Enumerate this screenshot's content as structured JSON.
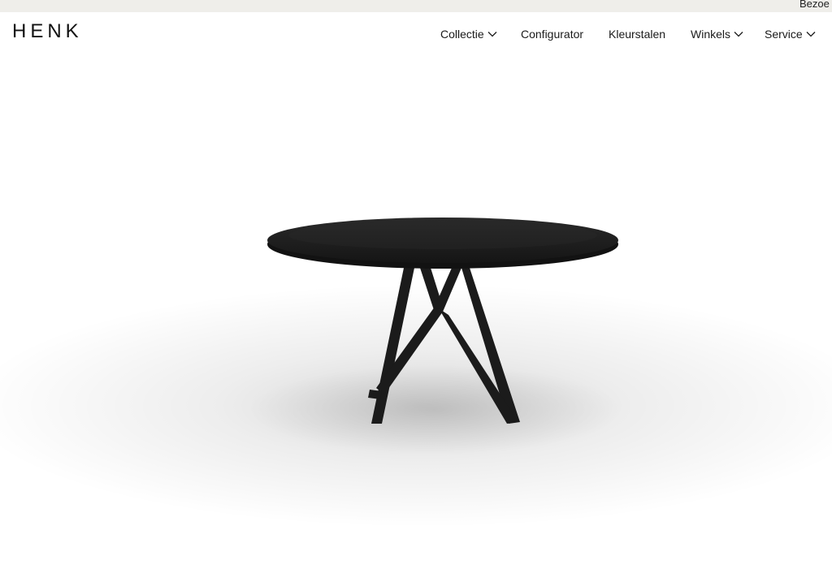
{
  "topbar": {
    "text": "Bezoe"
  },
  "header": {
    "logo": "HENK",
    "nav": [
      {
        "label": "Collectie",
        "has_dropdown": true
      },
      {
        "label": "Configurator",
        "has_dropdown": false
      },
      {
        "label": "Kleurstalen",
        "has_dropdown": false
      },
      {
        "label": "Winkels",
        "has_dropdown": true
      },
      {
        "label": "Service",
        "has_dropdown": true
      }
    ]
  },
  "hero": {
    "image": "round-black-dining-table",
    "colors": {
      "table": "#1b1b1b",
      "background": "#ffffff"
    }
  }
}
